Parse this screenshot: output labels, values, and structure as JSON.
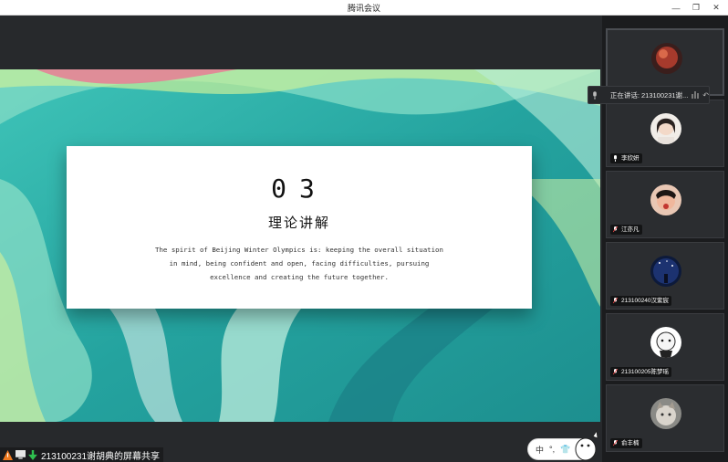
{
  "window": {
    "title": "腾讯会议",
    "controls": {
      "minimize": "—",
      "restore": "❐",
      "close": "✕"
    }
  },
  "slide": {
    "number": "03",
    "heading": "理论讲解",
    "body_lines": [
      "The spirit of Beijing Winter Olympics is: keeping the overall situation",
      "in mind, being confident and open, facing difficulties, pursuing",
      "excellence and creating the future together."
    ]
  },
  "speaking_indicator": {
    "text": "正在讲话: 213100231谢..."
  },
  "participants": [
    {
      "name": "",
      "avatar": "dark-red"
    },
    {
      "name": "李欣妍",
      "avatar": "girl"
    },
    {
      "name": "江亦凡",
      "avatar": "red-face"
    },
    {
      "name": "213100240汉紫宸",
      "avatar": "night-sky"
    },
    {
      "name": "213100205陈梦瑶",
      "avatar": "white-cartoon"
    },
    {
      "name": "俞丰楠",
      "avatar": "cat"
    }
  ],
  "share_status": {
    "label": "213100231谢胡典的屏幕共享"
  },
  "ime": {
    "lang": "中",
    "punct": "°,"
  },
  "colors": {
    "panel_bg": "#1b1c1e",
    "tile_bg": "#2b2d30",
    "slide_teal": "#2aa6a0",
    "share_icon_orange": "#f07a1f",
    "share_icon_green": "#2fbf4f"
  }
}
